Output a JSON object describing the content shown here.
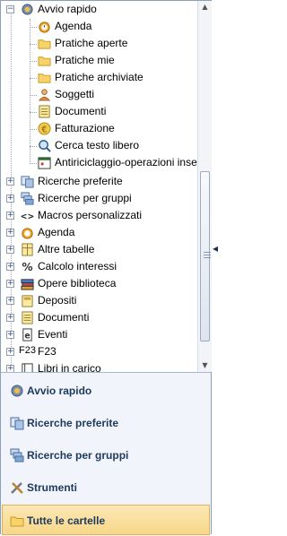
{
  "tree": {
    "root": {
      "label": "Avvio rapido",
      "expanded": true
    },
    "children": [
      {
        "label": "Agenda",
        "icon": "agenda-icon"
      },
      {
        "label": "Pratiche aperte",
        "icon": "folder-icon"
      },
      {
        "label": "Pratiche mie",
        "icon": "folder-icon"
      },
      {
        "label": "Pratiche archiviate",
        "icon": "folder-icon"
      },
      {
        "label": "Soggetti",
        "icon": "person-icon"
      },
      {
        "label": "Documenti",
        "icon": "documents-icon"
      },
      {
        "label": "Fatturazione",
        "icon": "euro-icon"
      },
      {
        "label": "Cerca testo libero",
        "icon": "search-icon"
      },
      {
        "label": "Antiriciclaggio-operazioni inserite",
        "icon": "calendar-icon"
      }
    ],
    "top_level": [
      {
        "label": "Ricerche preferite",
        "icon": "favorites-icon"
      },
      {
        "label": "Ricerche per gruppi",
        "icon": "groups-icon"
      },
      {
        "label": "Macros personalizzati",
        "icon": "macro-icon"
      },
      {
        "label": "Agenda",
        "icon": "agenda-icon"
      },
      {
        "label": "Altre tabelle",
        "icon": "table-icon"
      },
      {
        "label": "Calcolo interessi",
        "icon": "percent-icon"
      },
      {
        "label": "Opere biblioteca",
        "icon": "books-icon"
      },
      {
        "label": "Depositi",
        "icon": "deposit-icon"
      },
      {
        "label": "Documenti",
        "icon": "documents-icon"
      },
      {
        "label": "Eventi",
        "icon": "events-icon"
      },
      {
        "label": "F23",
        "icon": "f23-icon",
        "icon_text": "F23"
      },
      {
        "label": "Libri in carico",
        "icon": "book-icon"
      }
    ]
  },
  "nav": {
    "items": [
      {
        "label": "Avvio rapido",
        "icon": "quick-start-icon",
        "selected": false
      },
      {
        "label": "Ricerche preferite",
        "icon": "favorites-icon",
        "selected": false
      },
      {
        "label": "Ricerche per gruppi",
        "icon": "groups-icon",
        "selected": false
      },
      {
        "label": "Strumenti",
        "icon": "tools-icon",
        "selected": false
      },
      {
        "label": "Tutte le cartelle",
        "icon": "folder-icon",
        "selected": true
      }
    ]
  },
  "colors": {
    "nav_text": "#1e395b",
    "selected_bg": "#f7d88a",
    "border": "#8c9fb8"
  }
}
